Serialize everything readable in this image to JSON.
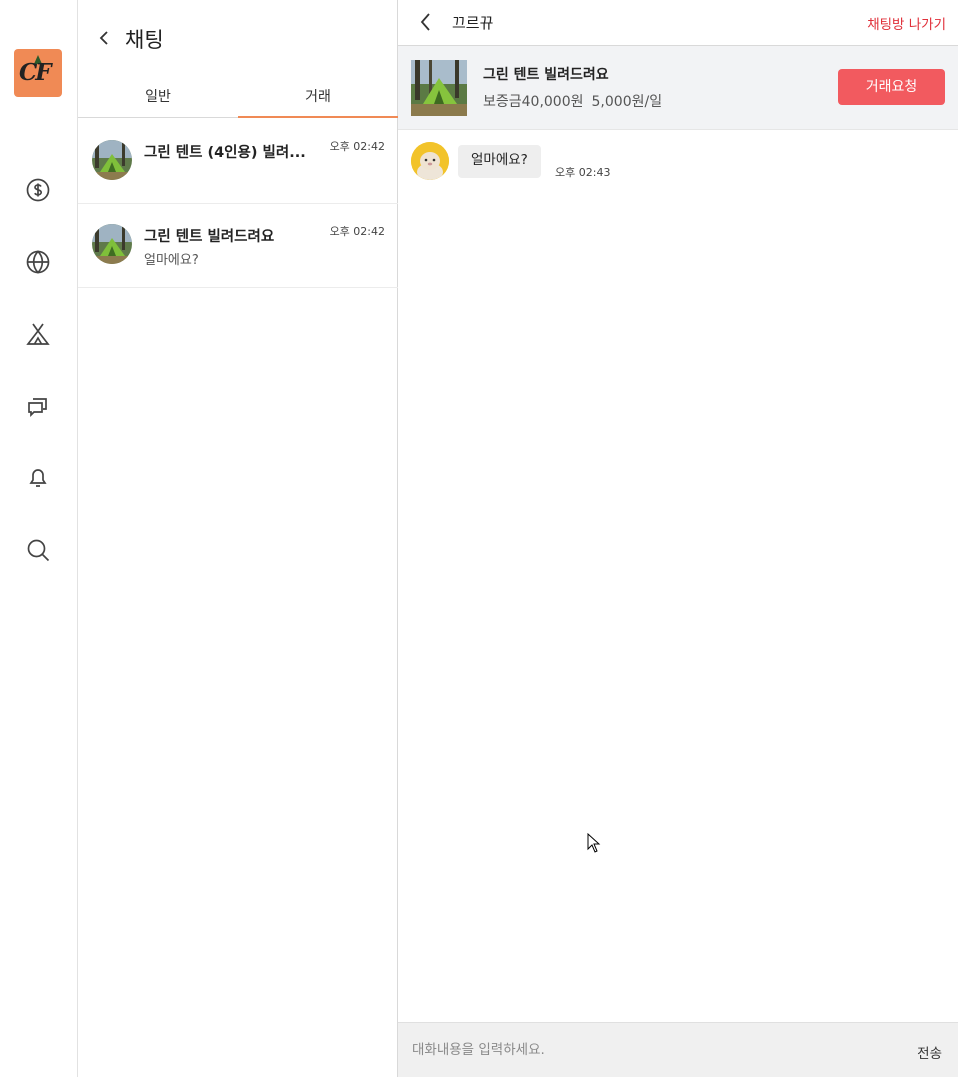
{
  "rail": {
    "logo_text": "CF",
    "icons": [
      "dollar-icon",
      "globe-icon",
      "tent-icon",
      "chat-icon",
      "bell-icon",
      "search-icon"
    ]
  },
  "chat_list": {
    "title": "채팅",
    "tabs": [
      {
        "label": "일반",
        "active": false
      },
      {
        "label": "거래",
        "active": true
      }
    ],
    "items": [
      {
        "title": "그린 텐트 (4인용) 빌려...",
        "time": "오후 02:42",
        "preview": ""
      },
      {
        "title": "그린 텐트 빌려드려요",
        "time": "오후 02:42",
        "preview": "얼마에요?"
      }
    ]
  },
  "conversation": {
    "partner_name": "끄르뀨",
    "leave_label": "채팅방 나가기",
    "product": {
      "title": "그린 텐트 빌려드려요",
      "deposit": "보증금40,000원",
      "daily_price": "5,000원/일",
      "trade_button": "거래요청"
    },
    "messages": [
      {
        "text": "얼마에요?",
        "time": "오후 02:43"
      }
    ],
    "composer": {
      "placeholder": "대화내용을 입력하세요.",
      "value": "",
      "send_label": "전송"
    }
  },
  "colors": {
    "accent": "#f08a55",
    "trade_button": "#f25a5f",
    "leave_text": "#e0303a"
  }
}
